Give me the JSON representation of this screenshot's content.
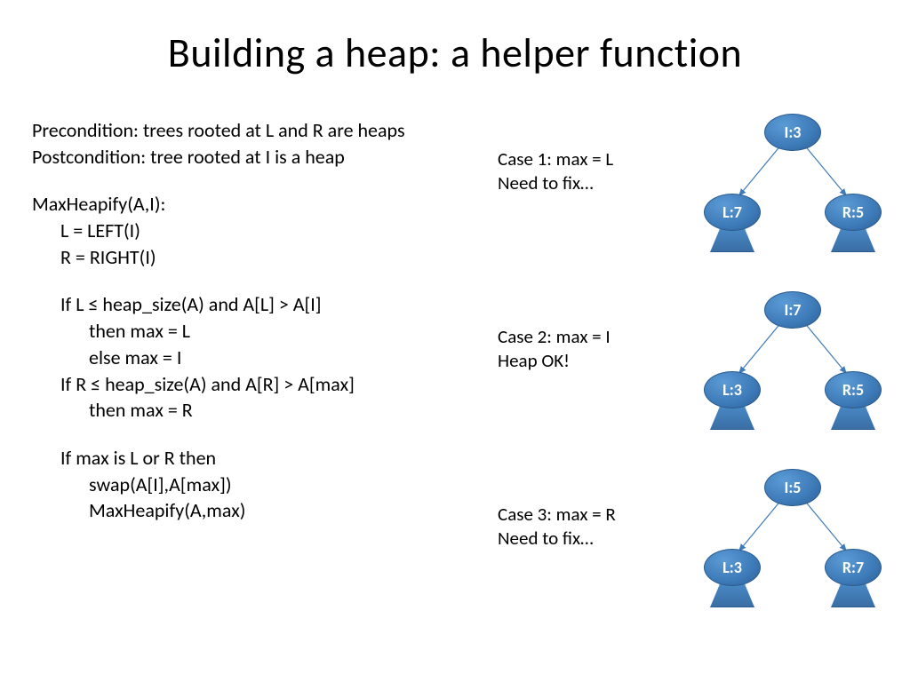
{
  "title": "Building a heap: a helper function",
  "pre": "Precondition: trees rooted at L and R are heaps",
  "post": "Postcondition: tree rooted at I is a heap",
  "fn": "MaxHeapify(A,I):",
  "l1": "L = LEFT(I)",
  "l2": "R = RIGHT(I)",
  "l3": "If L ≤ heap_size(A) and A[L] > A[I]",
  "l4": "then max = L",
  "l5": "else max = I",
  "l6": "If R ≤ heap_size(A) and A[R] > A[max]",
  "l7": "then max = R",
  "l8": "If max is L or R then",
  "l9": "swap(A[I],A[max])",
  "l10": "MaxHeapify(A,max)",
  "c1a": "Case 1: max = L",
  "c1b": "Need to fix…",
  "c2a": "Case 2: max = I",
  "c2b": "Heap OK!",
  "c3a": "Case 3: max = R",
  "c3b": "Need to fix…",
  "t1": {
    "root": "I:3",
    "left": "L:7",
    "right": "R:5"
  },
  "t2": {
    "root": "I:7",
    "left": "L:3",
    "right": "R:5"
  },
  "t3": {
    "root": "I:5",
    "left": "L:3",
    "right": "R:7"
  }
}
